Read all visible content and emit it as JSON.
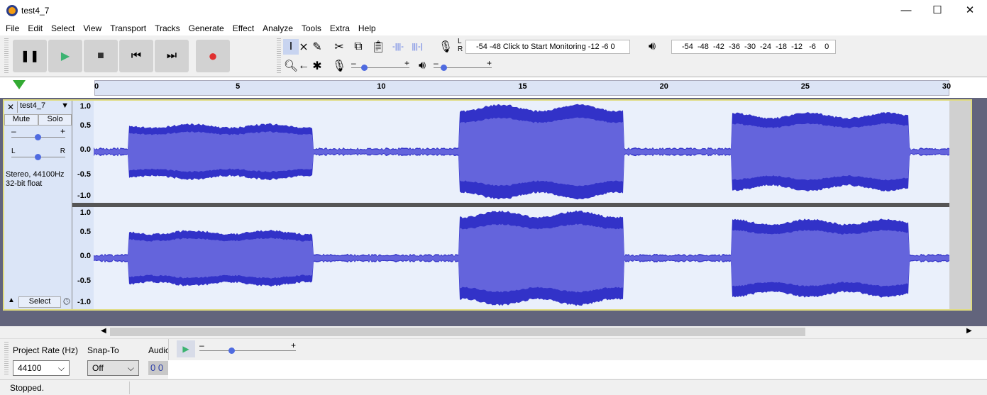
{
  "window": {
    "title": "test4_7",
    "minimize": "—",
    "maximize": "☐",
    "close": "✕"
  },
  "menu": [
    "File",
    "Edit",
    "Select",
    "View",
    "Transport",
    "Tracks",
    "Generate",
    "Effect",
    "Analyze",
    "Tools",
    "Extra",
    "Help"
  ],
  "transport": {
    "pause": "❚❚",
    "play": "▶",
    "stop": "■",
    "skip_start": "⏮",
    "skip_end": "⏭",
    "record": "●"
  },
  "recording_meter": {
    "lr": "L R",
    "scale": "-54  -48",
    "click_text": "Click to Start Monitoring",
    "scale2": "-12   -6    0"
  },
  "playback_meter": {
    "scale": "-54  -48  -42  -36  -30  -24  -18  -12   -6    0"
  },
  "slider_labels": {
    "minus": "–",
    "plus": "+"
  },
  "ruler": {
    "ticks": [
      "0",
      "5",
      "10",
      "15",
      "20",
      "25",
      "30"
    ]
  },
  "track": {
    "name": "test4_7",
    "mute": "Mute",
    "solo": "Solo",
    "pan_left": "L",
    "pan_right": "R",
    "info_line1": "Stereo, 44100Hz",
    "info_line2": "32-bit float",
    "select": "Select",
    "gain": 0.5,
    "pan": 0.5,
    "scale": [
      "1.0",
      "0.5",
      "0.0",
      "-0.5",
      "-1.0"
    ]
  },
  "bottom": {
    "project_rate_label": "Project Rate (Hz)",
    "project_rate_value": "44100",
    "snap_label": "Snap-To",
    "snap_value": "Off",
    "audio_label": "Audio",
    "audio_value": "0 0"
  },
  "status": "Stopped.",
  "colors": {
    "wave": "#3232c8",
    "wave_rms": "#6464dc",
    "accent": "#4f6be0"
  }
}
